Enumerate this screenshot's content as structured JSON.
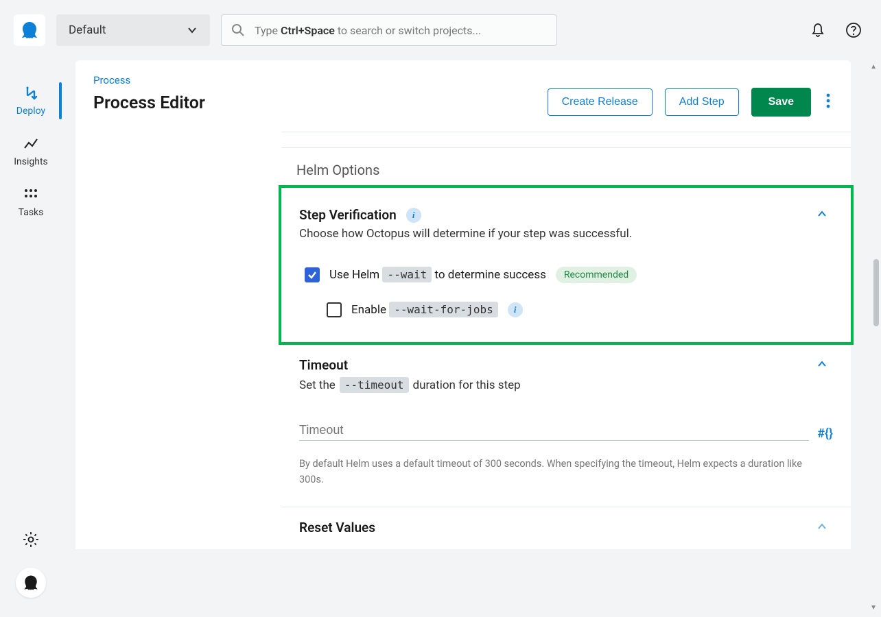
{
  "topbar": {
    "space": "Default",
    "search_prefix": "Type ",
    "search_kbd": "Ctrl+Space",
    "search_suffix": " to search or switch projects..."
  },
  "sidebar": {
    "items": [
      {
        "label": "Deploy"
      },
      {
        "label": "Insights"
      },
      {
        "label": "Tasks"
      }
    ]
  },
  "header": {
    "breadcrumb": "Process",
    "title": "Process Editor",
    "create_release": "Create Release",
    "add_step": "Add Step",
    "save": "Save"
  },
  "helm": {
    "title": "Helm Options",
    "verification": {
      "title": "Step Verification",
      "desc": "Choose how Octopus will determine if your step was successful.",
      "use_wait_prefix": "Use Helm ",
      "wait_code": "--wait",
      "use_wait_suffix": " to determine success",
      "recommended": "Recommended",
      "enable_prefix": "Enable ",
      "wait_jobs_code": "--wait-for-jobs",
      "wait_checked": true,
      "wait_jobs_checked": false
    },
    "timeout": {
      "title": "Timeout",
      "desc_prefix": "Set the ",
      "timeout_code": "--timeout",
      "desc_suffix": " duration for this step",
      "input_label": "Timeout",
      "helper": "By default Helm uses a default timeout of 300 seconds. When specifying the timeout, Helm expects a duration like 300s.",
      "var_glyph": "#{}"
    },
    "reset": {
      "title": "Reset Values"
    }
  }
}
